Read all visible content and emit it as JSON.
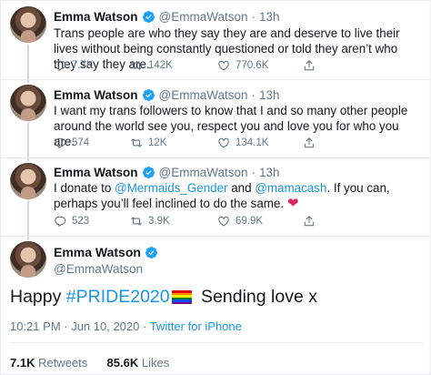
{
  "tweets": [
    {
      "name": "Emma Watson",
      "handle": "@EmmaWatson",
      "separator": "·",
      "time": "13h",
      "text": "Trans people are who they say they are and deserve to live their lives without being constantly questioned or told they aren’t who they say they are.",
      "replies": "7.7K",
      "retweets": "142K",
      "likes": "770.6K"
    },
    {
      "name": "Emma Watson",
      "handle": "@EmmaWatson",
      "separator": "·",
      "time": "13h",
      "text": "I want my trans followers to know that I and so many other people around the world see you, respect you and love you for who you are.",
      "replies": "574",
      "retweets": "12K",
      "likes": "134.1K"
    },
    {
      "name": "Emma Watson",
      "handle": "@EmmaWatson",
      "separator": "·",
      "time": "13h",
      "text_before": "I donate to ",
      "mention1": "@Mermaids_Gender",
      "text_mid": " and ",
      "mention2": "@mamacash",
      "text_after": ". If you can, perhaps you’ll feel inclined to do the same. ",
      "emoji": "❤",
      "replies": "523",
      "retweets": "3.9K",
      "likes": "69.9K"
    }
  ],
  "main_tweet": {
    "name": "Emma Watson",
    "handle": "@EmmaWatson",
    "text_before": "Happy ",
    "hashtag": "#PRIDE2020",
    "text_after": " Sending love x",
    "timestamp": "10:21 PM · Jun 10, 2020 · ",
    "source": "Twitter for iPhone",
    "retweet_count": "7.1K",
    "retweet_label": " Retweets",
    "like_count": "85.6K",
    "like_label": " Likes"
  },
  "icons": {
    "verified": "verified-badge-icon",
    "reply": "reply-icon",
    "retweet": "retweet-icon",
    "like": "heart-icon",
    "share": "share-icon",
    "flag": "rainbow-flag-icon"
  },
  "colors": {
    "link": "#1b95e0",
    "verified": "#1da1f2",
    "muted": "#657786",
    "heart": "#e0245e"
  }
}
